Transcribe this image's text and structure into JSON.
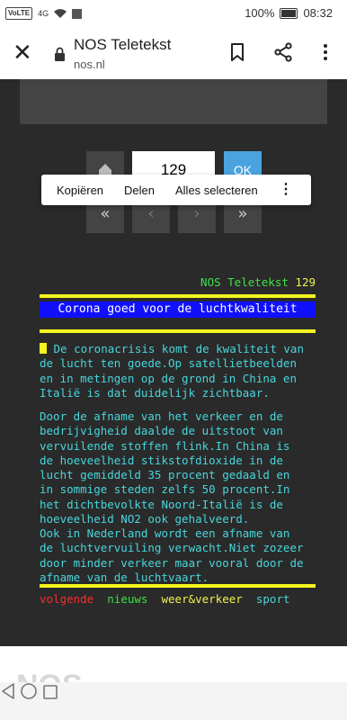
{
  "status": {
    "carrier_badge": "VoLTE",
    "signal": "4G",
    "battery": "100%",
    "time": "08:32"
  },
  "browser": {
    "title": "NOS Teletekst",
    "url": "nos.nl"
  },
  "page_nav": {
    "page_number": "129",
    "ok_label": "OK",
    "prev_label": "«",
    "next_label": "»",
    "sub_prev_label": "‹",
    "sub_next_label": "›"
  },
  "context_menu": {
    "copy": "Kopiëren",
    "share": "Delen",
    "select_all": "Alles selecteren"
  },
  "teletext": {
    "header_name": "NOS Teletekst",
    "header_page": "129",
    "headline": "Corona goed voor de luchtkwaliteit",
    "paragraph1": " De coronacrisis komt de kwaliteit van\nde lucht ten goede.Op satellietbeelden\nen in metingen op de grond in China en\nItalië is dat duidelijk zichtbaar.",
    "paragraph2": "Door de afname van het verkeer en de\nbedrijvigheid daalde de uitstoot van\nvervuilende stoffen flink.In China is\nde hoeveelheid stikstofdioxide in de\nlucht gemiddeld 35 procent gedaald en\nin sommige steden zelfs 50 procent.In\nhet dichtbevolkte Noord-Italië is de\nhoeveelheid NO2 ook gehalveerd.",
    "paragraph3": "Ook in Nederland wordt een afname van\nde luchtvervuiling verwacht.Niet zozeer\ndoor minder verkeer maar vooral door de\nafname van de luchtvaart.",
    "links": {
      "next": "volgende",
      "news": "nieuws",
      "weather": "weer&verkeer",
      "sport": "sport"
    }
  },
  "colors": {
    "background": "#2a2a2a",
    "cyan": "#48d6dc",
    "yellow": "#f5f51e",
    "blue": "#1010ff",
    "green": "#3ee04a",
    "red": "#ff2a2a"
  },
  "footer_logo_partial": "NOS"
}
